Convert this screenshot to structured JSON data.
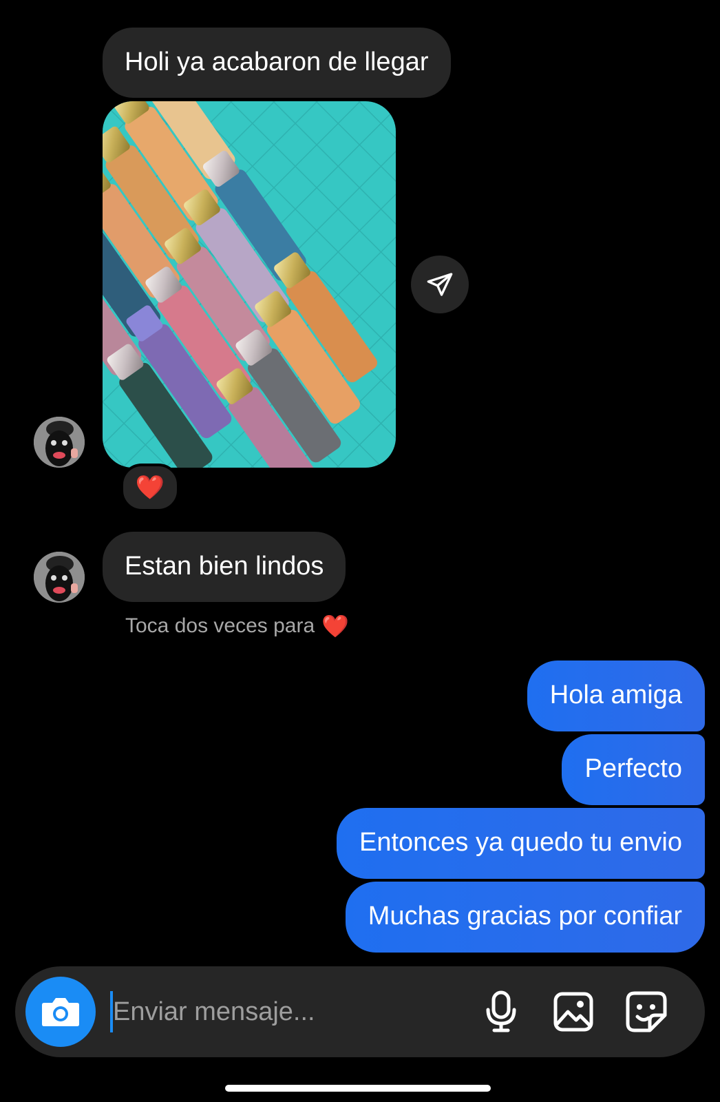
{
  "messages": {
    "incoming": [
      {
        "text": "Holi ya acabaron de llegar"
      },
      {
        "text": "Estan bien lindos"
      }
    ],
    "photo": {
      "reaction_emoji": "❤️",
      "share_icon": "paper-plane-icon"
    },
    "hint": {
      "text": "Toca dos veces para",
      "emoji": "❤️"
    },
    "outgoing": [
      {
        "text": "Hola amiga"
      },
      {
        "text": "Perfecto"
      },
      {
        "text": "Entonces ya quedo tu envio"
      },
      {
        "text": "Muchas gracias por confiar"
      }
    ]
  },
  "composer": {
    "placeholder": "Enviar mensaje...",
    "icons": [
      "camera-icon",
      "microphone-icon",
      "gallery-icon",
      "sticker-icon"
    ]
  },
  "colors": {
    "background": "#000000",
    "incoming_bubble": "#262626",
    "outgoing_bubble": "#2f6ae8",
    "camera_button": "#1a8cf5",
    "hint_text": "#a8a8a8"
  }
}
